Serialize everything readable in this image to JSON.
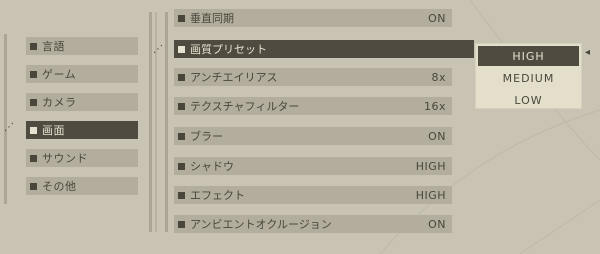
{
  "categories": [
    {
      "label": "言語",
      "active": false
    },
    {
      "label": "ゲーム",
      "active": false
    },
    {
      "label": "カメラ",
      "active": false
    },
    {
      "label": "画面",
      "active": true
    },
    {
      "label": "サウンド",
      "active": false
    },
    {
      "label": "その他",
      "active": false
    }
  ],
  "options": [
    {
      "label": "垂直同期",
      "value": "ON"
    },
    {
      "label": "画質プリセット",
      "value": ""
    },
    {
      "label": "アンチエイリアス",
      "value": "8x"
    },
    {
      "label": "テクスチャフィルター",
      "value": "16x"
    },
    {
      "label": "ブラー",
      "value": "ON"
    },
    {
      "label": "シャドウ",
      "value": "HIGH"
    },
    {
      "label": "エフェクト",
      "value": "HIGH"
    },
    {
      "label": "アンビエントオクルージョン",
      "value": "ON"
    }
  ],
  "dropdown": {
    "items": [
      "HIGH",
      "MEDIUM",
      "LOW"
    ],
    "selected": "HIGH"
  },
  "colors": {
    "background": "#c8c3b2",
    "panel": "#b2ad9d",
    "active": "#4f4b40",
    "dropdown": "#e4dfca"
  }
}
